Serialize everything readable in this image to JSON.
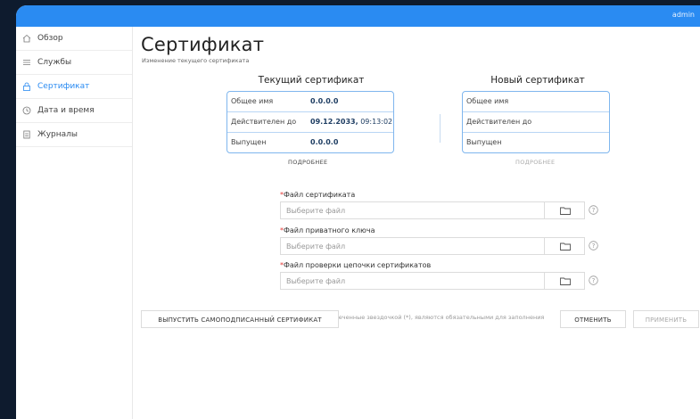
{
  "topbar": {
    "user": "admin"
  },
  "sidebar": {
    "items": [
      {
        "label": "Обзор",
        "icon": "home-icon",
        "active": false
      },
      {
        "label": "Службы",
        "icon": "list-icon",
        "active": false
      },
      {
        "label": "Сертификат",
        "icon": "lock-icon",
        "active": true
      },
      {
        "label": "Дата и время",
        "icon": "clock-icon",
        "active": false
      },
      {
        "label": "Журналы",
        "icon": "document-icon",
        "active": false
      }
    ]
  },
  "main": {
    "title": "Сертификат",
    "subtitle": "Изменение текущего сертификата",
    "current": {
      "heading": "Текущий сертификат",
      "rows": [
        {
          "key": "Общее имя",
          "value": "0.0.0.0",
          "extra": ""
        },
        {
          "key": "Действителен до",
          "value": "09.12.2033,",
          "extra": " 09:13:02"
        },
        {
          "key": "Выпущен",
          "value": "0.0.0.0",
          "extra": ""
        }
      ],
      "details": "ПОДРОБНЕЕ"
    },
    "new": {
      "heading": "Новый сертификат",
      "rows": [
        {
          "key": "Общее имя"
        },
        {
          "key": "Действителен до"
        },
        {
          "key": "Выпущен"
        }
      ],
      "details": "ПОДРОБНЕЕ"
    },
    "fields": [
      {
        "label": "Файл сертификата",
        "placeholder": "Выберите файл"
      },
      {
        "label": "Файл приватного ключа",
        "placeholder": "Выберите файл"
      },
      {
        "label": "Файл проверки цепочки сертификатов",
        "placeholder": "Выберите файл"
      }
    ],
    "required_mark": "*",
    "hint": "Поля, отмеченные звездочкой (*), являются обязательными для заполнения",
    "buttons": {
      "self_signed": "ВЫПУСТИТЬ САМОПОДПИСАННЫЙ СЕРТИФИКАТ",
      "cancel": "ОТМЕНИТЬ",
      "apply": "ПРИМЕНИТЬ"
    }
  },
  "colors": {
    "accent": "#2a8bf2",
    "border": "#7fb6ee",
    "required": "#e53935"
  }
}
